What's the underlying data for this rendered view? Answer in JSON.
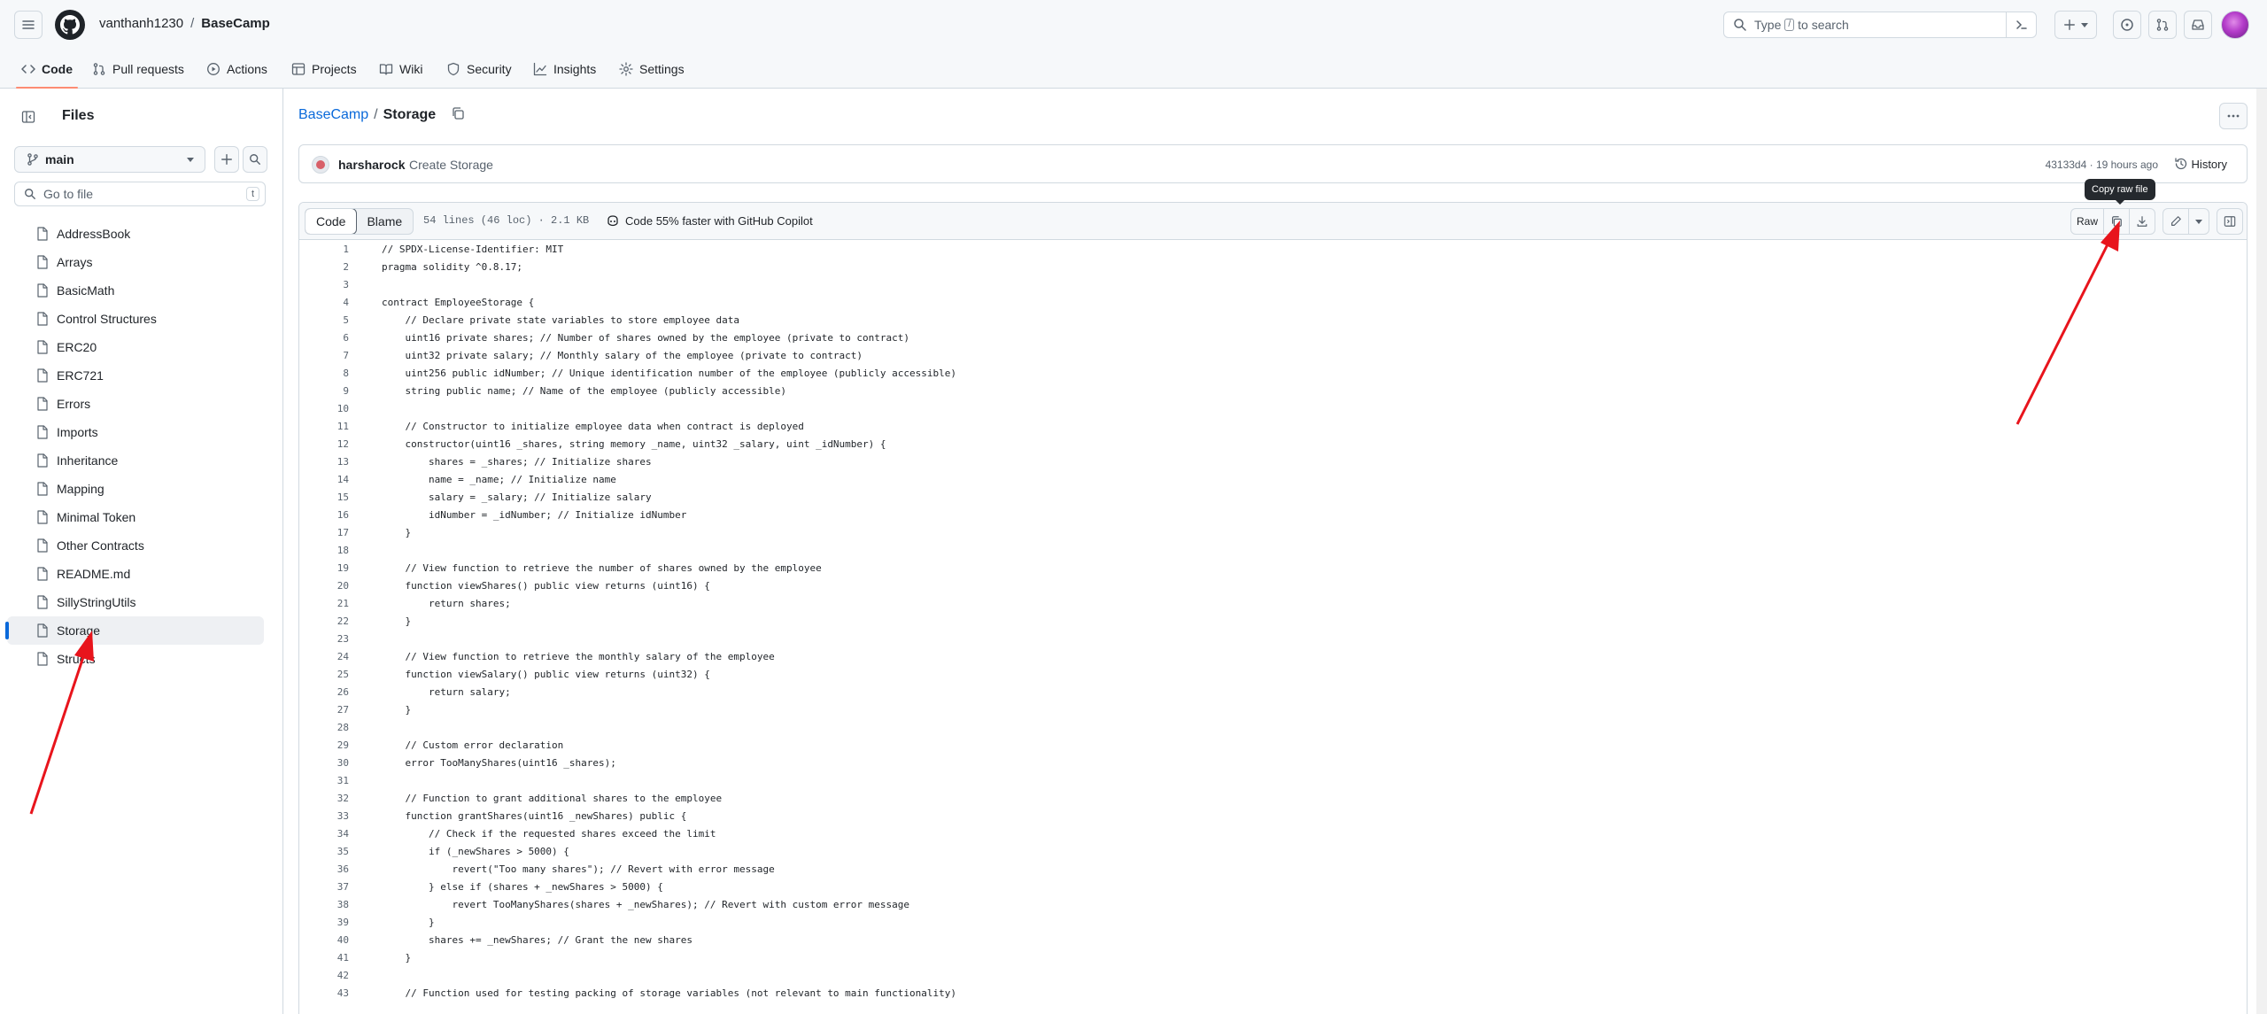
{
  "header": {
    "owner": "vanthanh1230",
    "repo": "BaseCamp",
    "search_placeholder_pre": "Type",
    "search_key": "/",
    "search_placeholder_post": "to search"
  },
  "tabs": [
    {
      "label": "Code",
      "icon": "code-icon"
    },
    {
      "label": "Pull requests",
      "icon": "git-pull-request-icon"
    },
    {
      "label": "Actions",
      "icon": "play-icon"
    },
    {
      "label": "Projects",
      "icon": "table-icon"
    },
    {
      "label": "Wiki",
      "icon": "book-icon"
    },
    {
      "label": "Security",
      "icon": "shield-icon"
    },
    {
      "label": "Insights",
      "icon": "graph-icon"
    },
    {
      "label": "Settings",
      "icon": "gear-icon"
    }
  ],
  "sidebar": {
    "title": "Files",
    "branch": "main",
    "goto_placeholder": "Go to file",
    "goto_key": "t",
    "items": [
      {
        "label": "AddressBook"
      },
      {
        "label": "Arrays"
      },
      {
        "label": "BasicMath"
      },
      {
        "label": "Control Structures"
      },
      {
        "label": "ERC20"
      },
      {
        "label": "ERC721"
      },
      {
        "label": "Errors"
      },
      {
        "label": "Imports"
      },
      {
        "label": "Inheritance"
      },
      {
        "label": "Mapping"
      },
      {
        "label": "Minimal Token"
      },
      {
        "label": "Other Contracts"
      },
      {
        "label": "README.md"
      },
      {
        "label": "SillyStringUtils"
      },
      {
        "label": "Storage",
        "active": true
      },
      {
        "label": "Structs"
      }
    ]
  },
  "breadcrumb": {
    "repo": "BaseCamp",
    "sep": "/",
    "file": "Storage"
  },
  "commit": {
    "author": "harsharock",
    "message": "Create Storage",
    "meta": "43133d4 · 19 hours ago",
    "history_label": "History"
  },
  "file": {
    "tab_code": "Code",
    "tab_blame": "Blame",
    "info": "54 lines (46 loc) · 2.1 KB",
    "copilot": "Code 55% faster with GitHub Copilot",
    "raw_label": "Raw",
    "tooltip": "Copy raw file"
  },
  "code_lines": [
    "// SPDX-License-Identifier: MIT",
    "pragma solidity ^0.8.17;",
    "",
    "contract EmployeeStorage {",
    "    // Declare private state variables to store employee data",
    "    uint16 private shares; // Number of shares owned by the employee (private to contract)",
    "    uint32 private salary; // Monthly salary of the employee (private to contract)",
    "    uint256 public idNumber; // Unique identification number of the employee (publicly accessible)",
    "    string public name; // Name of the employee (publicly accessible)",
    "",
    "    // Constructor to initialize employee data when contract is deployed",
    "    constructor(uint16 _shares, string memory _name, uint32 _salary, uint _idNumber) {",
    "        shares = _shares; // Initialize shares",
    "        name = _name; // Initialize name",
    "        salary = _salary; // Initialize salary",
    "        idNumber = _idNumber; // Initialize idNumber",
    "    }",
    "",
    "    // View function to retrieve the number of shares owned by the employee",
    "    function viewShares() public view returns (uint16) {",
    "        return shares;",
    "    }",
    "",
    "    // View function to retrieve the monthly salary of the employee",
    "    function viewSalary() public view returns (uint32) {",
    "        return salary;",
    "    }",
    "",
    "    // Custom error declaration",
    "    error TooManyShares(uint16 _shares);",
    "",
    "    // Function to grant additional shares to the employee",
    "    function grantShares(uint16 _newShares) public {",
    "        // Check if the requested shares exceed the limit",
    "        if (_newShares > 5000) {",
    "            revert(\"Too many shares\"); // Revert with error message",
    "        } else if (shares + _newShares > 5000) {",
    "            revert TooManyShares(shares + _newShares); // Revert with custom error message",
    "        }",
    "        shares += _newShares; // Grant the new shares",
    "    }",
    "",
    "    // Function used for testing packing of storage variables (not relevant to main functionality)"
  ],
  "colors": {
    "accent": "#0969da",
    "tab_underline": "#fd8c73",
    "arrow": "#e8141c"
  }
}
